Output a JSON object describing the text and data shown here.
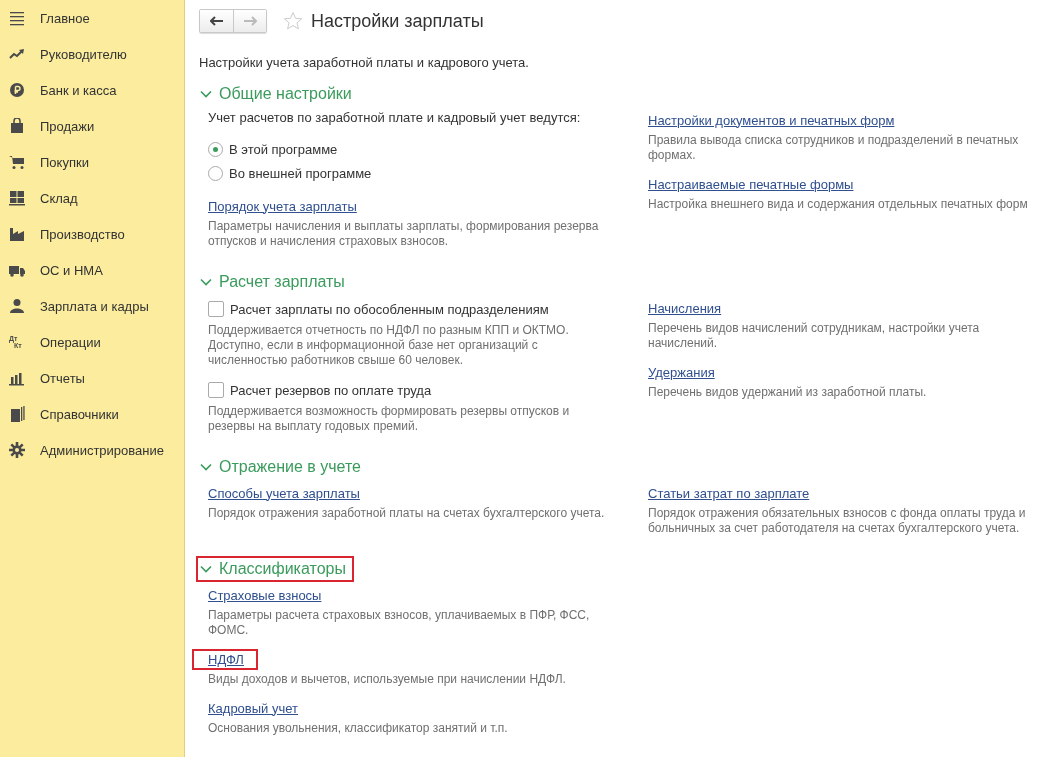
{
  "sidebar": {
    "items": [
      {
        "label": "Главное"
      },
      {
        "label": "Руководителю"
      },
      {
        "label": "Банк и касса"
      },
      {
        "label": "Продажи"
      },
      {
        "label": "Покупки"
      },
      {
        "label": "Склад"
      },
      {
        "label": "Производство"
      },
      {
        "label": "ОС и НМА"
      },
      {
        "label": "Зарплата и кадры"
      },
      {
        "label": "Операции",
        "icon_text": [
          "Дт",
          "Кт"
        ]
      },
      {
        "label": "Отчеты"
      },
      {
        "label": "Справочники"
      },
      {
        "label": "Администрирование"
      }
    ]
  },
  "page": {
    "title": "Настройки зарплаты",
    "favorite": false,
    "back_enabled": true,
    "forward_enabled": false,
    "intro": "Настройки учета заработной платы и кадрового учета."
  },
  "sections": [
    {
      "title": "Общие настройки",
      "expanded": true,
      "highlighted": false,
      "left": [
        {
          "kind": "text",
          "label": "Учет расчетов по заработной плате и кадровый учет ведутся:"
        },
        {
          "kind": "radio",
          "options": [
            {
              "label": "В этой программе",
              "selected": true
            },
            {
              "label": "Во внешней программе",
              "selected": false
            }
          ]
        },
        {
          "kind": "link",
          "label": "Порядок учета зарплаты",
          "description": "Параметры начисления и выплаты зарплаты, формирования резерва отпусков и начисления страховых взносов.",
          "highlighted": false
        }
      ],
      "right": [
        {
          "kind": "link",
          "label": "Настройки документов и печатных форм",
          "description": "Правила вывода списка сотрудников и подразделений в печатных формах.",
          "highlighted": false
        },
        {
          "kind": "link",
          "label": "Настраиваемые печатные формы",
          "description": "Настройка внешнего вида и содержания отдельных печатных форм",
          "highlighted": false
        }
      ]
    },
    {
      "title": "Расчет зарплаты",
      "expanded": true,
      "highlighted": false,
      "left": [
        {
          "kind": "checkbox",
          "label": "Расчет зарплаты по обособленным подразделениям",
          "checked": false,
          "description": "Поддерживается отчетность по НДФЛ по разным КПП и ОКТМО.\nДоступно, если в информационной базе нет организаций с численностью работников свыше 60 человек."
        },
        {
          "kind": "checkbox",
          "label": "Расчет резервов по оплате труда",
          "checked": false,
          "description": "Поддерживается возможность формировать резервы отпусков и резервы на выплату годовых премий."
        }
      ],
      "right": [
        {
          "kind": "link",
          "label": "Начисления",
          "description": "Перечень видов начислений сотрудникам, настройки учета начислений.",
          "highlighted": false
        },
        {
          "kind": "link",
          "label": "Удержания",
          "description": "Перечень видов удержаний из заработной платы.",
          "highlighted": false
        }
      ]
    },
    {
      "title": "Отражение в учете",
      "expanded": true,
      "highlighted": false,
      "left": [
        {
          "kind": "link",
          "label": "Способы учета зарплаты",
          "description": "Порядок отражения заработной платы на счетах бухгалтерского учета.",
          "highlighted": false
        }
      ],
      "right": [
        {
          "kind": "link",
          "label": "Статьи затрат по зарплате",
          "description": "Порядок отражения обязательных взносов с фонда оплаты труда и больничных за счет работодателя на счетах бухгалтерского учета.",
          "highlighted": false
        }
      ]
    },
    {
      "title": "Классификаторы",
      "expanded": true,
      "highlighted": true,
      "left": [
        {
          "kind": "link",
          "label": "Страховые взносы",
          "description": "Параметры расчета страховых взносов, уплачиваемых в ПФР, ФСС, ФОМС.",
          "highlighted": false
        },
        {
          "kind": "link",
          "label": "НДФЛ",
          "description": "Виды доходов и вычетов, используемые при начислении НДФЛ.",
          "highlighted": true
        },
        {
          "kind": "link",
          "label": "Кадровый учет",
          "description": "Основания увольнения, классификатор занятий и т.п.",
          "highlighted": false
        }
      ]
    }
  ]
}
